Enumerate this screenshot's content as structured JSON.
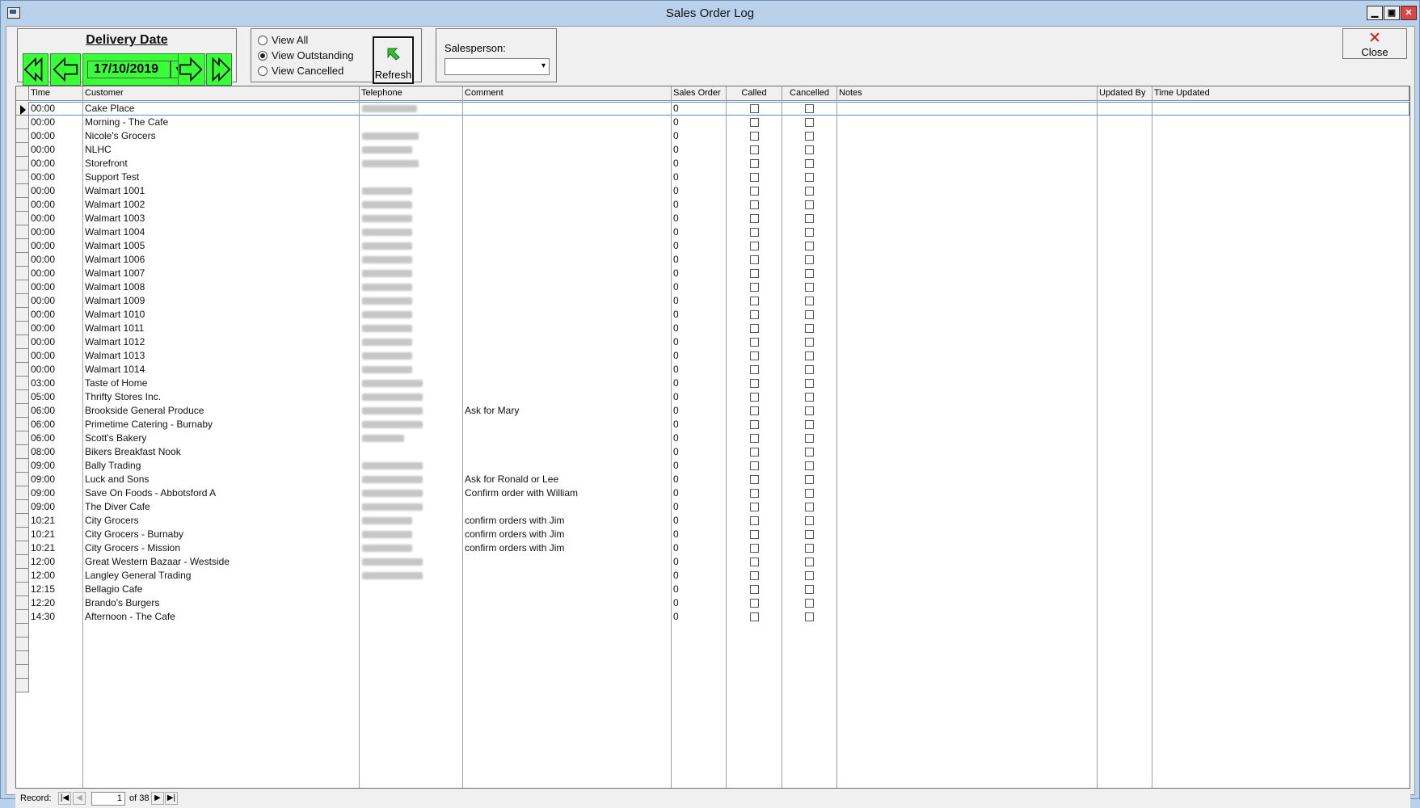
{
  "window": {
    "title": "Sales Order Log"
  },
  "delivery": {
    "title": "Delivery Date",
    "date": "17/10/2019"
  },
  "view": {
    "options": [
      {
        "label": "View All",
        "checked": false
      },
      {
        "label": "View Outstanding",
        "checked": true
      },
      {
        "label": "View Cancelled",
        "checked": false
      }
    ],
    "refresh_label": "Refresh"
  },
  "salesperson": {
    "label": "Salesperson:",
    "value": ""
  },
  "close": {
    "label": "Close"
  },
  "grid": {
    "columns": [
      "Time",
      "Customer",
      "Telephone",
      "Comment",
      "Sales Order",
      "Called",
      "Cancelled",
      "Notes",
      "Updated By",
      "Time Updated"
    ],
    "rows": [
      {
        "time": "00:00",
        "customer": "Cake Place",
        "tel": true,
        "comment": "",
        "so": "0"
      },
      {
        "time": "00:00",
        "customer": "Morning - The Cafe",
        "tel": false,
        "comment": "",
        "so": "0"
      },
      {
        "time": "00:00",
        "customer": "Nicole's Grocers",
        "tel": true,
        "comment": "",
        "so": "0"
      },
      {
        "time": "00:00",
        "customer": "NLHC",
        "tel": true,
        "comment": "",
        "so": "0"
      },
      {
        "time": "00:00",
        "customer": "Storefront",
        "tel": true,
        "comment": "",
        "so": "0"
      },
      {
        "time": "00:00",
        "customer": "Support Test",
        "tel": false,
        "comment": "",
        "so": "0"
      },
      {
        "time": "00:00",
        "customer": "Walmart 1001",
        "tel": true,
        "comment": "",
        "so": "0"
      },
      {
        "time": "00:00",
        "customer": "Walmart 1002",
        "tel": true,
        "comment": "",
        "so": "0"
      },
      {
        "time": "00:00",
        "customer": "Walmart 1003",
        "tel": true,
        "comment": "",
        "so": "0"
      },
      {
        "time": "00:00",
        "customer": "Walmart 1004",
        "tel": true,
        "comment": "",
        "so": "0"
      },
      {
        "time": "00:00",
        "customer": "Walmart 1005",
        "tel": true,
        "comment": "",
        "so": "0"
      },
      {
        "time": "00:00",
        "customer": "Walmart 1006",
        "tel": true,
        "comment": "",
        "so": "0"
      },
      {
        "time": "00:00",
        "customer": "Walmart 1007",
        "tel": true,
        "comment": "",
        "so": "0"
      },
      {
        "time": "00:00",
        "customer": "Walmart 1008",
        "tel": true,
        "comment": "",
        "so": "0"
      },
      {
        "time": "00:00",
        "customer": "Walmart 1009",
        "tel": true,
        "comment": "",
        "so": "0"
      },
      {
        "time": "00:00",
        "customer": "Walmart 1010",
        "tel": true,
        "comment": "",
        "so": "0"
      },
      {
        "time": "00:00",
        "customer": "Walmart 1011",
        "tel": true,
        "comment": "",
        "so": "0"
      },
      {
        "time": "00:00",
        "customer": "Walmart 1012",
        "tel": true,
        "comment": "",
        "so": "0"
      },
      {
        "time": "00:00",
        "customer": "Walmart 1013",
        "tel": true,
        "comment": "",
        "so": "0"
      },
      {
        "time": "00:00",
        "customer": "Walmart 1014",
        "tel": true,
        "comment": "",
        "so": "0"
      },
      {
        "time": "03:00",
        "customer": "Taste of Home",
        "tel": true,
        "comment": "",
        "so": "0"
      },
      {
        "time": "05:00",
        "customer": "Thrifty Stores Inc.",
        "tel": true,
        "comment": "",
        "so": "0"
      },
      {
        "time": "06:00",
        "customer": "Brookside General Produce",
        "tel": true,
        "comment": "Ask for Mary",
        "so": "0"
      },
      {
        "time": "06:00",
        "customer": "Primetime Catering - Burnaby",
        "tel": true,
        "comment": "",
        "so": "0"
      },
      {
        "time": "06:00",
        "customer": "Scott's Bakery",
        "tel": true,
        "comment": "",
        "so": "0"
      },
      {
        "time": "08:00",
        "customer": "Bikers Breakfast Nook",
        "tel": false,
        "comment": "",
        "so": "0"
      },
      {
        "time": "09:00",
        "customer": "Bally Trading",
        "tel": true,
        "comment": "",
        "so": "0"
      },
      {
        "time": "09:00",
        "customer": "Luck and Sons",
        "tel": true,
        "comment": "Ask for Ronald or Lee",
        "so": "0"
      },
      {
        "time": "09:00",
        "customer": "Save On Foods - Abbotsford A",
        "tel": true,
        "comment": "Confirm order with William",
        "so": "0"
      },
      {
        "time": "09:00",
        "customer": "The Diver Cafe",
        "tel": true,
        "comment": "",
        "so": "0"
      },
      {
        "time": "10:21",
        "customer": "City Grocers",
        "tel": true,
        "comment": "confirm orders with Jim",
        "so": "0"
      },
      {
        "time": "10:21",
        "customer": "City Grocers - Burnaby",
        "tel": true,
        "comment": "confirm orders with Jim",
        "so": "0"
      },
      {
        "time": "10:21",
        "customer": "City Grocers - Mission",
        "tel": true,
        "comment": "confirm orders with Jim",
        "so": "0"
      },
      {
        "time": "12:00",
        "customer": "Great Western Bazaar - Westside",
        "tel": true,
        "comment": "",
        "so": "0"
      },
      {
        "time": "12:00",
        "customer": "Langley General Trading",
        "tel": true,
        "comment": "",
        "so": "0"
      },
      {
        "time": "12:15",
        "customer": "Bellagio Cafe",
        "tel": false,
        "comment": "",
        "so": "0"
      },
      {
        "time": "12:20",
        "customer": "Brando's Burgers",
        "tel": false,
        "comment": "",
        "so": "0"
      },
      {
        "time": "14:30",
        "customer": "Afternoon - The Cafe",
        "tel": false,
        "comment": "",
        "so": "0"
      }
    ]
  },
  "nav": {
    "label": "Record:",
    "current": "1",
    "total_text": "of 38"
  }
}
